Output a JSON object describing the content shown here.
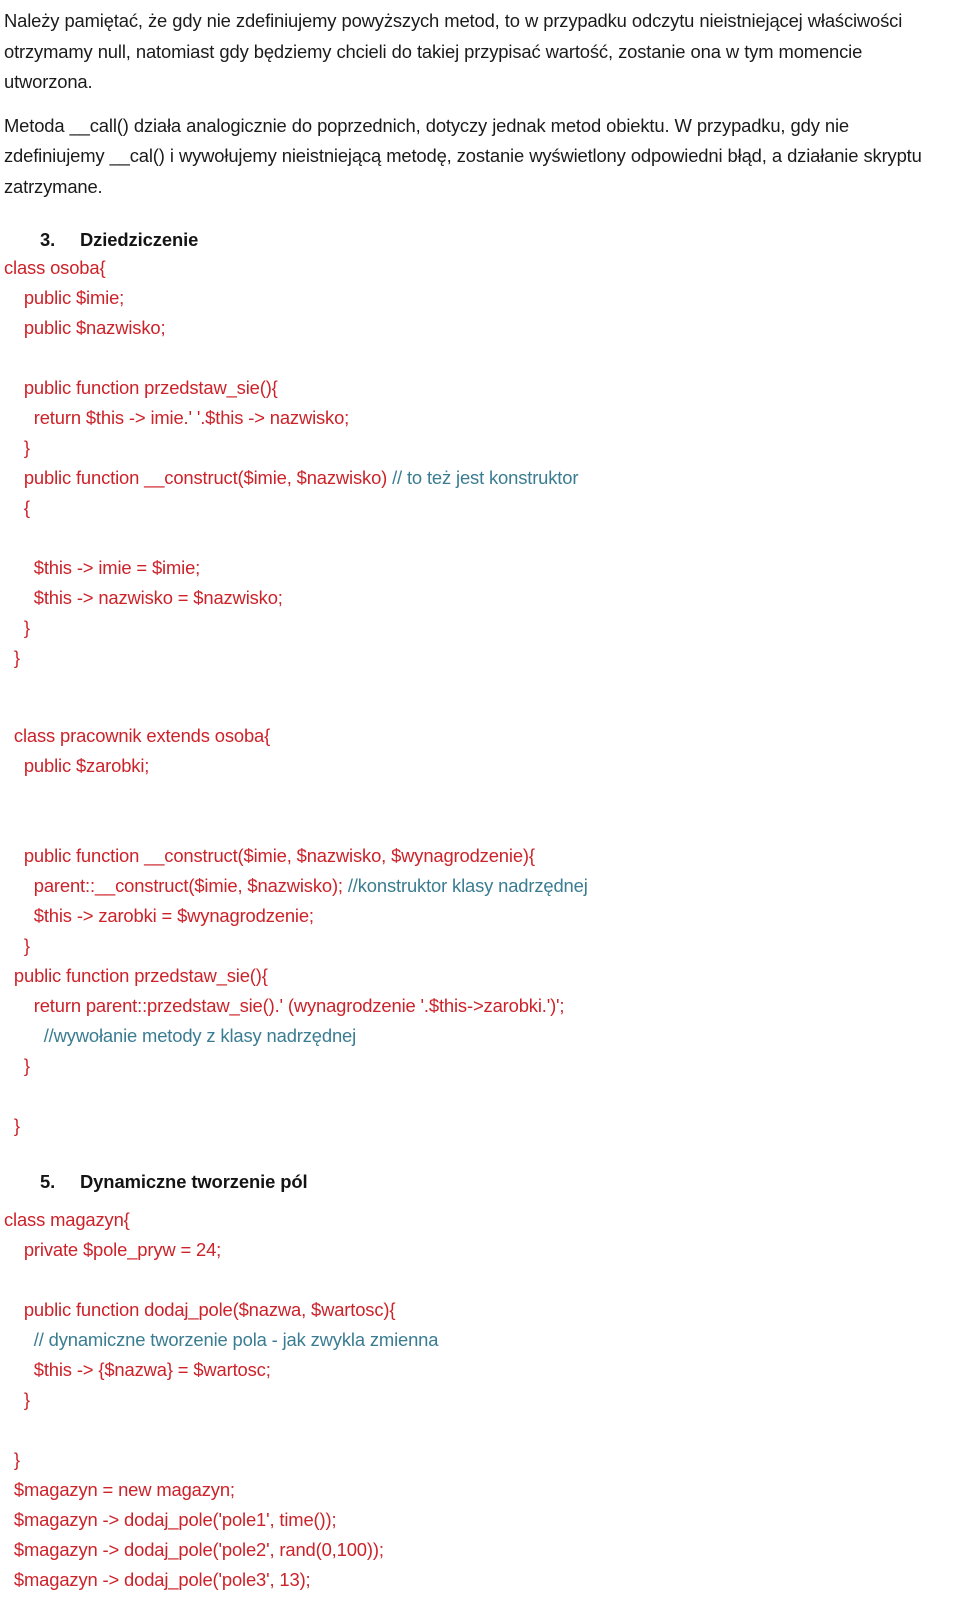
{
  "document": {
    "language": "pl",
    "colors": {
      "code_red": "#cc2229",
      "comment_teal": "#3a7c91",
      "body_text": "#1b1b1b",
      "background": "#ffffff"
    }
  },
  "prose": {
    "paragraph_1": "Należy pamiętać, że gdy nie zdefiniujemy powyższych metod, to w przypadku odczytu nieistniejącej właściwości otrzymamy null, natomiast gdy będziemy chcieli do takiej przypisać wartość, zostanie ona w tym momencie utworzona.",
    "paragraph_2": "Metoda __call() działa analogicznie do poprzednich, dotyczy jednak metod obiektu. W przypadku, gdy nie zdefiniujemy __cal() i wywołujemy nieistniejącą metodę, zostanie wyświetlony odpowiedni błąd, a działanie skryptu zatrzymane."
  },
  "sections": [
    {
      "number": "3.",
      "title": "Dziedziczenie"
    },
    {
      "number": "5.",
      "title": "Dynamiczne tworzenie pól"
    }
  ],
  "code_blocks": {
    "osoba": {
      "lines": [
        {
          "code": "class osoba{",
          "comment": ""
        },
        {
          "code": "    public $imie;",
          "comment": ""
        },
        {
          "code": "    public $nazwisko;",
          "comment": ""
        },
        {
          "code": "",
          "comment": ""
        },
        {
          "code": "    public function przedstaw_sie(){",
          "comment": ""
        },
        {
          "code": "      return $this -> imie.' '.$this -> nazwisko;",
          "comment": ""
        },
        {
          "code": "    }",
          "comment": ""
        },
        {
          "code": "    public function __construct($imie, $nazwisko) ",
          "comment": "// to też jest konstruktor"
        },
        {
          "code": "    {",
          "comment": ""
        },
        {
          "code": "",
          "comment": ""
        },
        {
          "code": "      $this -> imie = $imie;",
          "comment": ""
        },
        {
          "code": "      $this -> nazwisko = $nazwisko;",
          "comment": ""
        },
        {
          "code": "    }",
          "comment": ""
        },
        {
          "code": "  }",
          "comment": ""
        }
      ]
    },
    "pracownik": {
      "lines": [
        {
          "code": "",
          "comment": ""
        },
        {
          "code": "  class pracownik extends osoba{",
          "comment": ""
        },
        {
          "code": "    public $zarobki;",
          "comment": ""
        },
        {
          "code": "",
          "comment": ""
        },
        {
          "code": "",
          "comment": ""
        },
        {
          "code": "    public function __construct($imie, $nazwisko, $wynagrodzenie){",
          "comment": ""
        },
        {
          "code": "      parent::__construct($imie, $nazwisko); ",
          "comment": "//konstruktor klasy nadrzędnej"
        },
        {
          "code": "      $this -> zarobki = $wynagrodzenie;",
          "comment": ""
        },
        {
          "code": "    }",
          "comment": ""
        },
        {
          "code": "  public function przedstaw_sie(){",
          "comment": ""
        },
        {
          "code": "      return parent::przedstaw_sie().' (wynagrodzenie '.$this->zarobki.')';",
          "comment": ""
        },
        {
          "code": "        ",
          "comment": "//wywołanie metody z klasy nadrzędnej"
        },
        {
          "code": "    }",
          "comment": ""
        },
        {
          "code": "",
          "comment": ""
        },
        {
          "code": "  }",
          "comment": ""
        }
      ]
    },
    "magazyn": {
      "lines": [
        {
          "code": "class magazyn{",
          "comment": ""
        },
        {
          "code": "    private $pole_pryw = 24;",
          "comment": ""
        },
        {
          "code": "",
          "comment": ""
        },
        {
          "code": "    public function dodaj_pole($nazwa, $wartosc){",
          "comment": ""
        },
        {
          "code": "      ",
          "comment": "// dynamiczne tworzenie pola - jak zwykla zmienna"
        },
        {
          "code": "      $this -> {$nazwa} = $wartosc;",
          "comment": ""
        },
        {
          "code": "    }",
          "comment": ""
        },
        {
          "code": "",
          "comment": ""
        },
        {
          "code": "  }",
          "comment": ""
        },
        {
          "code": "  $magazyn = new magazyn;",
          "comment": ""
        },
        {
          "code": "  $magazyn -> dodaj_pole('pole1', time());",
          "comment": ""
        },
        {
          "code": "  $magazyn -> dodaj_pole('pole2', rand(0,100));",
          "comment": ""
        },
        {
          "code": "  $magazyn -> dodaj_pole('pole3', 13);",
          "comment": ""
        }
      ]
    }
  }
}
